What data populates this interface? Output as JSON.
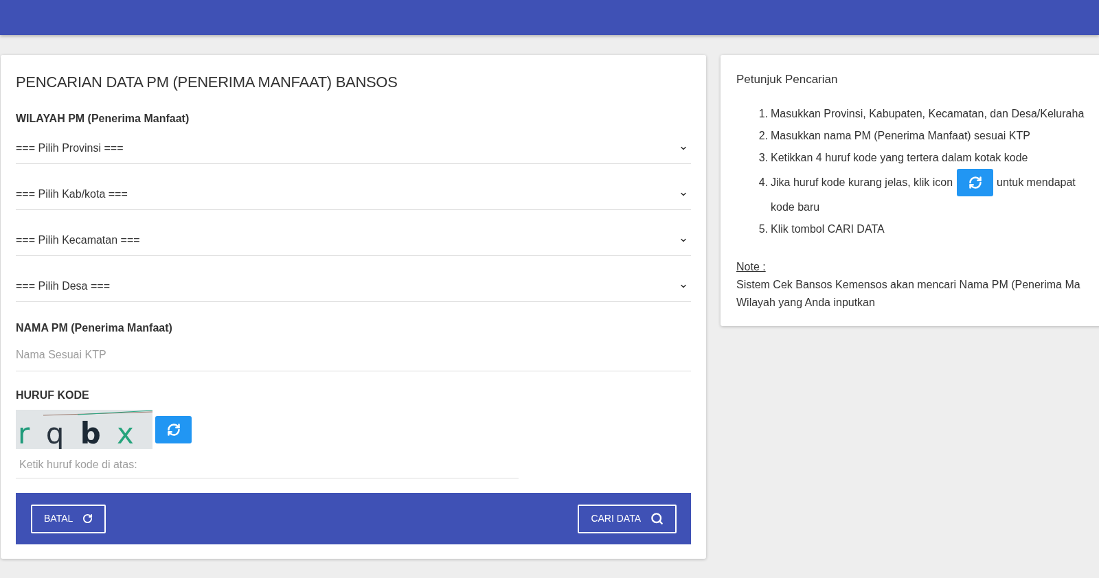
{
  "search_form": {
    "title": "PENCARIAN DATA PM (PENERIMA MANFAAT) BANSOS",
    "region": {
      "label": "WILAYAH PM (Penerima Manfaat)",
      "selects": [
        {
          "value": "=== Pilih Provinsi ==="
        },
        {
          "value": "=== Pilih Kab/kota ==="
        },
        {
          "value": "=== Pilih Kecamatan ==="
        },
        {
          "value": "=== Pilih Desa ==="
        }
      ]
    },
    "name": {
      "label": "NAMA PM (Penerima Manfaat)",
      "placeholder": "Nama Sesuai KTP"
    },
    "code": {
      "label": "HURUF KODE",
      "captcha_text": "r q b x",
      "placeholder": "Ketik huruf kode di atas:"
    },
    "actions": [
      {
        "label": "BATAL",
        "kind": "reset"
      },
      {
        "label": "CARI DATA",
        "kind": "search"
      }
    ]
  },
  "guide": {
    "title": "Petunjuk Pencarian",
    "steps": [
      {
        "number": "1.",
        "kind": "text",
        "text": "Masukkan Provinsi, Kabupaten, Kecamatan, dan Desa/Keluraha"
      },
      {
        "number": "2.",
        "kind": "text",
        "text": "Masukkan nama PM (Penerima Manfaat) sesuai KTP"
      },
      {
        "number": "3.",
        "kind": "text",
        "text": "Ketikkan 4 huruf kode yang tertera dalam kotak kode"
      },
      {
        "number": "4.",
        "kind": "with_icon",
        "text_before": "Jika huruf kode kurang jelas, klik icon",
        "text_after": "untuk mendapat",
        "continuation": "kode baru"
      },
      {
        "number": "5.",
        "kind": "text",
        "text": "Klik tombol CARI DATA"
      }
    ],
    "note": {
      "label": "Note :",
      "lines": [
        "Sistem Cek Bansos Kemensos akan mencari Nama PM (Penerima Ma",
        "Wilayah yang Anda inputkan"
      ]
    }
  }
}
